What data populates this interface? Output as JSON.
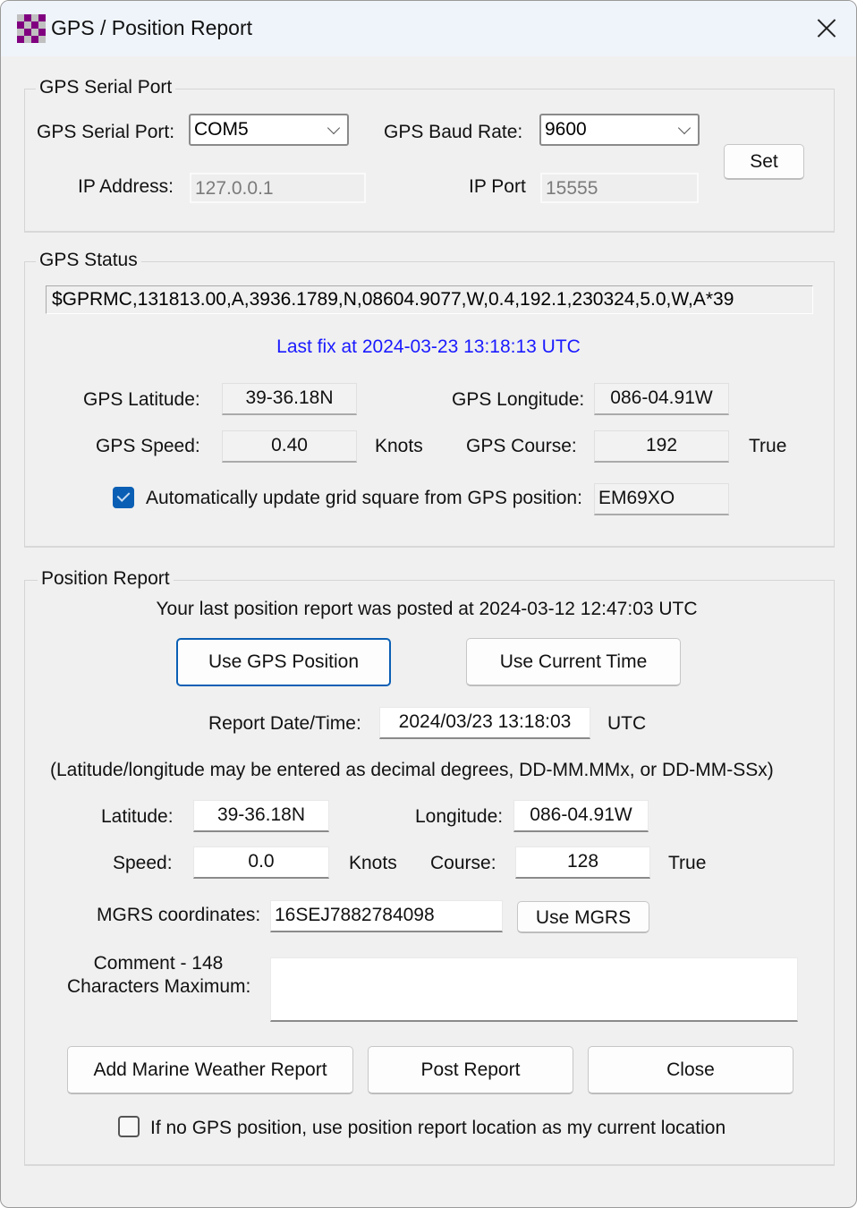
{
  "window": {
    "title": "GPS / Position Report",
    "icon": "checkerboard-app-icon",
    "close_icon": "close-icon"
  },
  "serial_port_group": {
    "legend": "GPS Serial Port",
    "serial_port_label": "GPS Serial Port:",
    "serial_port_value": "COM5",
    "baud_rate_label": "GPS Baud Rate:",
    "baud_rate_value": "9600",
    "ip_address_label": "IP Address:",
    "ip_address_value": "127.0.0.1",
    "ip_port_label": "IP Port",
    "ip_port_value": "15555",
    "set_button": "Set"
  },
  "gps_status_group": {
    "legend": "GPS Status",
    "nmea_sentence": "$GPRMC,131813.00,A,3936.1789,N,08604.9077,W,0.4,192.1,230324,5.0,W,A*39",
    "last_fix": "Last fix at 2024-03-23 13:18:13 UTC",
    "latitude_label": "GPS Latitude:",
    "latitude_value": "39-36.18N",
    "longitude_label": "GPS Longitude:",
    "longitude_value": "086-04.91W",
    "speed_label": "GPS Speed:",
    "speed_value": "0.40",
    "speed_unit": "Knots",
    "course_label": "GPS Course:",
    "course_value": "192",
    "course_unit": "True",
    "auto_update_label": "Automatically update grid square from GPS position:",
    "auto_update_checked": true,
    "grid_square_value": "EM69XO"
  },
  "position_report_group": {
    "legend": "Position Report",
    "last_report": "Your last position report was posted at 2024-03-12 12:47:03 UTC",
    "use_gps_position_button": "Use GPS Position",
    "use_current_time_button": "Use Current Time",
    "report_datetime_label": "Report Date/Time:",
    "report_datetime_value": "2024/03/23 13:18:03",
    "report_datetime_unit": "UTC",
    "format_hint": "(Latitude/longitude may be entered as decimal degrees, DD-MM.MMx, or DD-MM-SSx)",
    "latitude_label": "Latitude:",
    "latitude_value": "39-36.18N",
    "longitude_label": "Longitude:",
    "longitude_value": "086-04.91W",
    "speed_label": "Speed:",
    "speed_value": "0.0",
    "speed_unit": "Knots",
    "course_label": "Course:",
    "course_value": "128",
    "course_unit": "True",
    "mgrs_label": "MGRS coordinates:",
    "mgrs_value": "16SEJ7882784098",
    "use_mgrs_button": "Use MGRS",
    "comment_label_line1": "Comment - 148",
    "comment_label_line2": "Characters Maximum:",
    "comment_value": "",
    "add_marine_weather_button": "Add Marine Weather Report",
    "post_report_button": "Post Report",
    "close_button": "Close",
    "fallback_location_label": "If no GPS position, use position report location as my current location",
    "fallback_location_checked": false
  }
}
